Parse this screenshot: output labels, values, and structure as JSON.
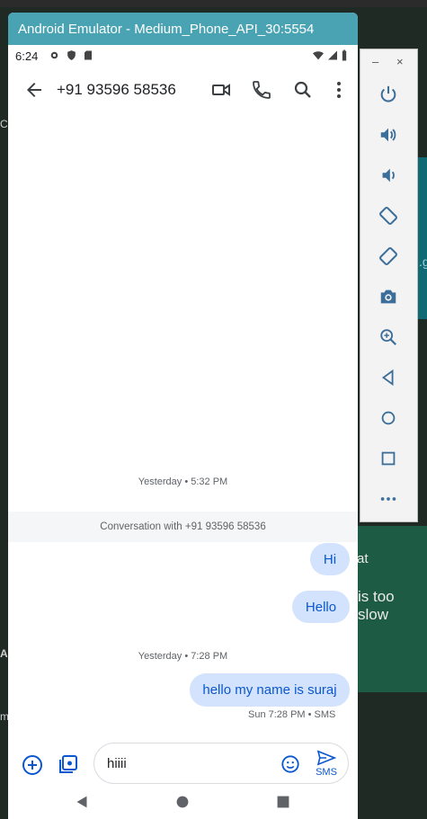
{
  "window": {
    "title": "Android Emulator - Medium_Phone_API_30:5554"
  },
  "status_bar": {
    "time": "6:24"
  },
  "app_bar": {
    "contact": "+91 93596 58536"
  },
  "conversation": {
    "date_1": "Yesterday • 5:32 PM",
    "conversation_with": "Conversation with +91 93596 58536",
    "messages_1": [
      "Hi",
      "Hello"
    ],
    "date_2": "Yesterday • 7:28 PM",
    "last_message": "hello my name is suraj",
    "last_message_meta": "Sun 7:28 PM • SMS"
  },
  "compose": {
    "text": "hiiii",
    "send_label": "SMS"
  },
  "background": {
    "right_text_1": "at",
    "right_text_2": "is too slow",
    "right_text_3": ".g",
    "left_text_1": "C",
    "left_text_2": "A",
    "left_text_3": "m"
  },
  "toolbar": {
    "minimize": "–",
    "close": "×",
    "buttons": [
      "power-icon",
      "volume-up-icon",
      "volume-down-icon",
      "rotate-left-icon",
      "rotate-right-icon",
      "camera-icon",
      "zoom-icon",
      "back-icon",
      "home-icon",
      "overview-icon",
      "more-icon"
    ]
  },
  "colors": {
    "title_bar": "#4aa3b3",
    "bubble": "#d3e3fd",
    "bubble_text": "#0b57d0",
    "toolbar_icon": "#3c6e9a"
  }
}
